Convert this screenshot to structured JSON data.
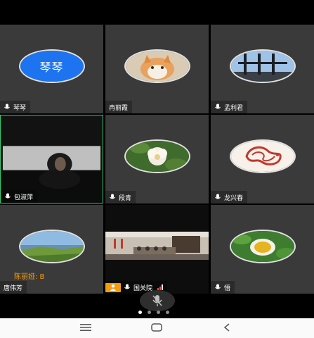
{
  "participants": [
    {
      "name": "琴琴",
      "avatar_text": "琴琴",
      "avatar_type": "text"
    },
    {
      "name": "冉丽霞",
      "avatar_type": "cat-photo"
    },
    {
      "name": "孟利君",
      "avatar_type": "window-photo"
    },
    {
      "name": "包淑萍",
      "avatar_type": "camera-video"
    },
    {
      "name": "段青",
      "avatar_type": "flower-photo"
    },
    {
      "name": "龙兴春",
      "avatar_type": "dragon-emblem"
    },
    {
      "name": "唐伟芳",
      "avatar_type": "landscape-photo",
      "overlay": "陈丽娅: B"
    },
    {
      "name": "国关院",
      "avatar_type": "classroom-video",
      "host_badge": true
    },
    {
      "name": "悟",
      "avatar_type": "tea-photo"
    }
  ],
  "colors": {
    "accent": "#1e73f0",
    "active_border": "#2ecc71",
    "host": "#f39c12"
  },
  "pager": {
    "pages": 4,
    "current": 1
  },
  "navbar": {
    "items": [
      "menu-icon",
      "home-icon",
      "back-icon"
    ]
  }
}
